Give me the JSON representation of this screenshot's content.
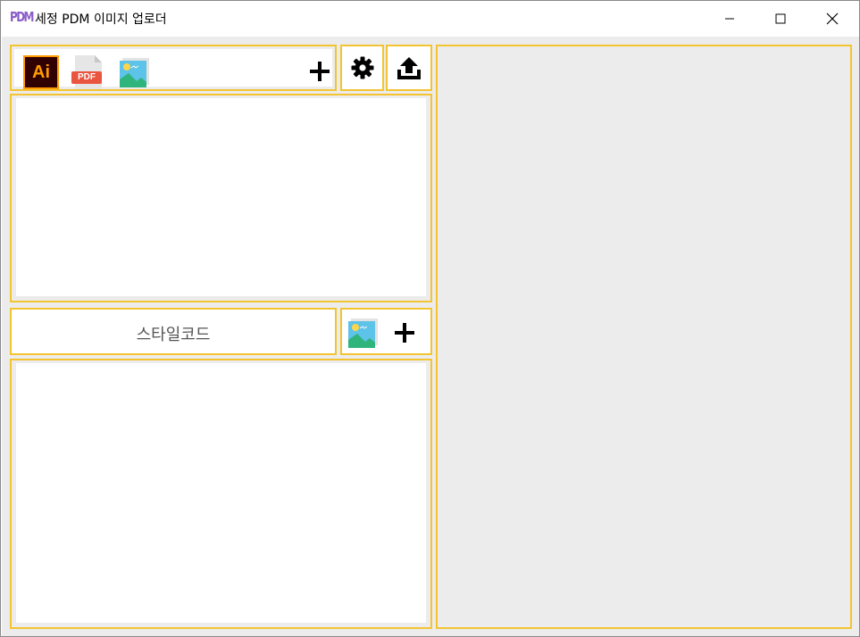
{
  "window": {
    "app_icon_text": "PDM",
    "title": "세정 PDM 이미지 업로더"
  },
  "toolbar": {
    "file_types": [
      {
        "name": "illustrator-icon",
        "label": "Ai"
      },
      {
        "name": "pdf-icon",
        "label": "PDF"
      },
      {
        "name": "image-icon"
      }
    ],
    "add_icon": "plus-icon",
    "settings_icon": "gear-icon",
    "upload_icon": "upload-icon"
  },
  "style_code": {
    "label": "스타일코드"
  },
  "colors": {
    "accent_border": "#f4c430",
    "background": "#ececec",
    "panel": "#ffffff"
  }
}
